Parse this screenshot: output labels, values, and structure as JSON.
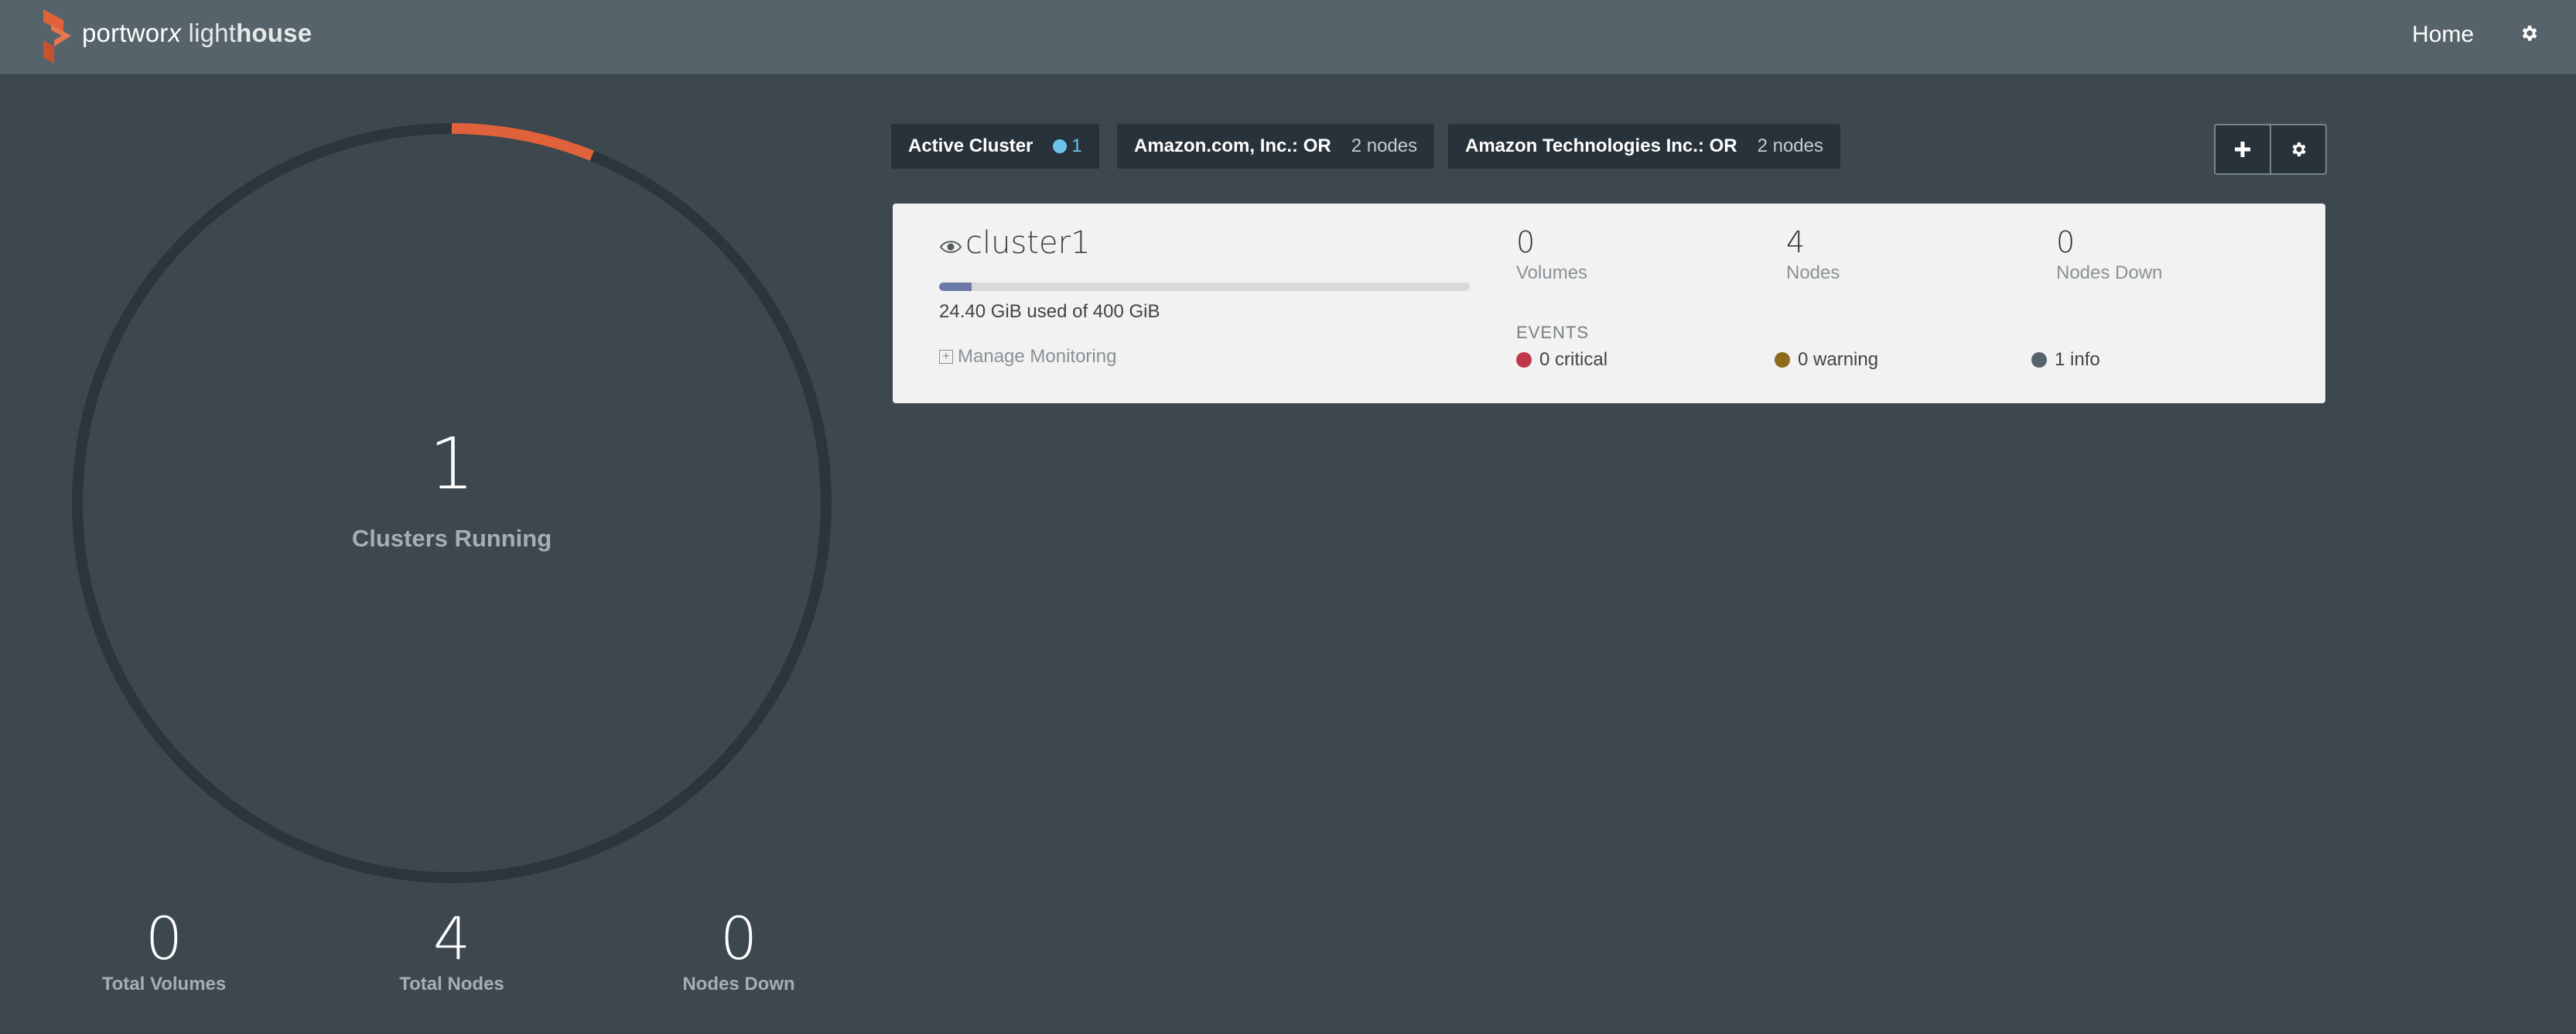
{
  "header": {
    "brand_part1": "portwor",
    "brand_part2": "lighthouse",
    "brand_x": "x",
    "nav_home": "Home",
    "icons": [
      "portworx-logo-icon",
      "gear-icon"
    ]
  },
  "summary": {
    "clusters_count": "1",
    "clusters_label": "Clusters Running",
    "total_volumes": "0",
    "total_volumes_label": "Total Volumes",
    "total_nodes": "4",
    "total_nodes_label": "Total Nodes",
    "nodes_down": "0",
    "nodes_down_label": "Nodes Down",
    "ring_color": "#2b353b",
    "arc_color": "#e0623a"
  },
  "filters": [
    {
      "name": "Active Cluster",
      "count": "1",
      "dot_color": "#6bc3ec"
    },
    {
      "name": "Amazon.com, Inc.: OR",
      "meta": "2 nodes"
    },
    {
      "name": "Amazon Technologies Inc.: OR",
      "meta": "2 nodes"
    }
  ],
  "actions": {
    "add_icon": "plus-icon",
    "settings_icon": "gear-icon"
  },
  "cluster": {
    "name": "cluster1",
    "eye_icon": "eye-icon",
    "usage_text": "24.40 GiB used of 400 GiB",
    "usage_fraction": 0.061,
    "manage_label": "Manage Monitoring",
    "volumes": "0",
    "volumes_label": "Volumes",
    "nodes": "4",
    "nodes_label": "Nodes",
    "nodes_down": "0",
    "nodes_down_label": "Nodes Down",
    "events_label": "EVENTS",
    "events": [
      {
        "label": "0 critical",
        "color": "#c0374a"
      },
      {
        "label": "0 warning",
        "color": "#8d6a1c"
      },
      {
        "label": "1 info",
        "color": "#56636a"
      }
    ]
  }
}
